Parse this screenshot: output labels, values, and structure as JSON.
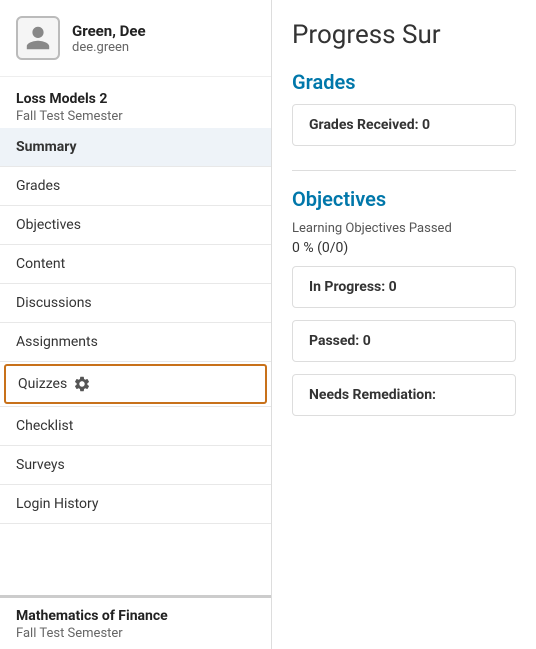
{
  "user": {
    "name": "Green, Dee",
    "login": "dee.green"
  },
  "course1": {
    "title": "Loss Models 2",
    "semester": "Fall Test Semester"
  },
  "course2": {
    "title": "Mathematics of Finance",
    "semester": "Fall Test Semester"
  },
  "sidebar": {
    "items": [
      {
        "id": "summary",
        "label": "Summary",
        "active": true
      },
      {
        "id": "grades",
        "label": "Grades",
        "active": false
      },
      {
        "id": "objectives",
        "label": "Objectives",
        "active": false
      },
      {
        "id": "content",
        "label": "Content",
        "active": false
      },
      {
        "id": "discussions",
        "label": "Discussions",
        "active": false
      },
      {
        "id": "assignments",
        "label": "Assignments",
        "active": false
      },
      {
        "id": "quizzes",
        "label": "Quizzes",
        "active": false,
        "special": true
      },
      {
        "id": "checklist",
        "label": "Checklist",
        "active": false
      },
      {
        "id": "surveys",
        "label": "Surveys",
        "active": false
      },
      {
        "id": "login-history",
        "label": "Login History",
        "active": false
      }
    ]
  },
  "main": {
    "page_title": "Progress Sur",
    "grades_section": {
      "heading": "Grades",
      "card_label": "Grades Received: 0"
    },
    "objectives_section": {
      "heading": "Objectives",
      "subtitle": "Learning Objectives Passed",
      "percent": "0 % (0/0)",
      "cards": [
        {
          "label": "In Progress: 0"
        },
        {
          "label": "Passed: 0"
        },
        {
          "label": "Needs Remediation:"
        }
      ]
    }
  }
}
